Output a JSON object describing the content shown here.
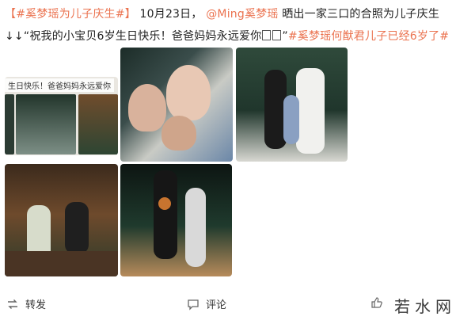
{
  "post": {
    "line1": {
      "tag": "【#奚梦瑶为儿子庆生#】",
      "date": "10月23日，",
      "mention": "@Ming奚梦瑶",
      "text": " 晒出一家三口的合照为儿子庆生"
    },
    "line2": {
      "quote": "↓↓“祝我的小宝贝6岁生日快乐！爸爸妈妈永远爱你",
      "quote_end": "”",
      "tag": "#奚梦瑶何猷君儿子已经6岁了#"
    }
  },
  "photos": {
    "strip_caption": "生日快乐！爸爸妈妈永远爱你"
  },
  "actions": {
    "repost_label": "转发",
    "comment_label": "评论",
    "like_icon": "thumbs-up-icon"
  },
  "watermark": "若水网",
  "colors": {
    "link": "#eb7350",
    "text": "#222222"
  }
}
